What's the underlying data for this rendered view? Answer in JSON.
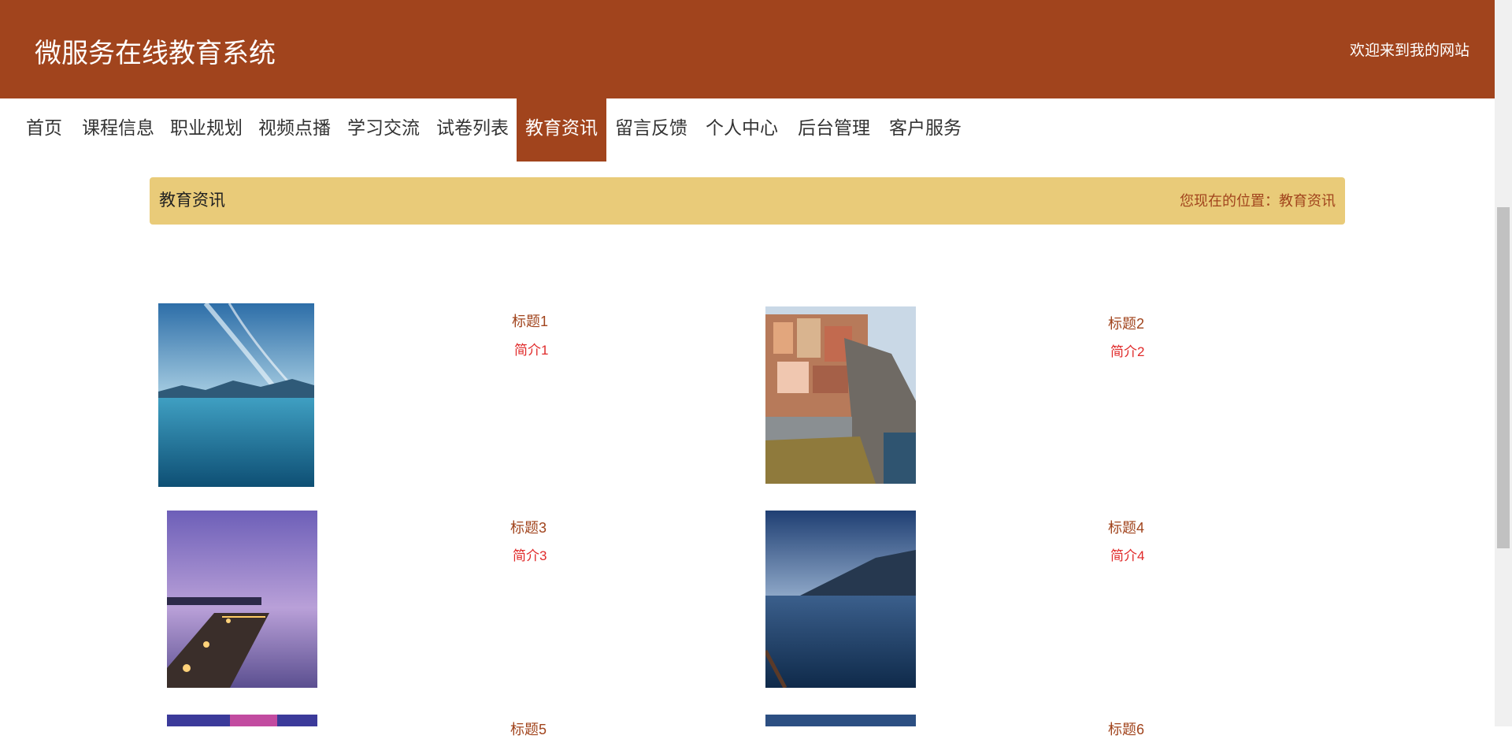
{
  "header": {
    "title": "微服务在线教育系统",
    "welcome": "欢迎来到我的网站",
    "color": "#a1441d"
  },
  "nav": {
    "items": [
      {
        "label": "首页"
      },
      {
        "label": "课程信息"
      },
      {
        "label": "职业规划"
      },
      {
        "label": "视频点播"
      },
      {
        "label": "学习交流"
      },
      {
        "label": "试卷列表"
      },
      {
        "label": "教育资讯",
        "active": true
      },
      {
        "label": "留言反馈"
      },
      {
        "label": "个人中心"
      },
      {
        "label": "后台管理"
      },
      {
        "label": "客户服务"
      }
    ]
  },
  "breadcrumb": {
    "title": "教育资讯",
    "location_prefix": "您现在的位置：",
    "location": "教育资讯",
    "background": "#e9cb79"
  },
  "news": [
    {
      "title": "标题1",
      "summary": "简介1",
      "image": "lake-mountains-photo"
    },
    {
      "title": "标题2",
      "summary": "简介2",
      "image": "cliff-village-photo"
    },
    {
      "title": "标题3",
      "summary": "简介3",
      "image": "pier-sunset-photo"
    },
    {
      "title": "标题4",
      "summary": "简介4",
      "image": "lakeside-town-photo"
    },
    {
      "title": "标题5",
      "summary": "",
      "image": "purple-sky-photo"
    },
    {
      "title": "标题6",
      "summary": "",
      "image": "blue-sky-photo"
    }
  ]
}
